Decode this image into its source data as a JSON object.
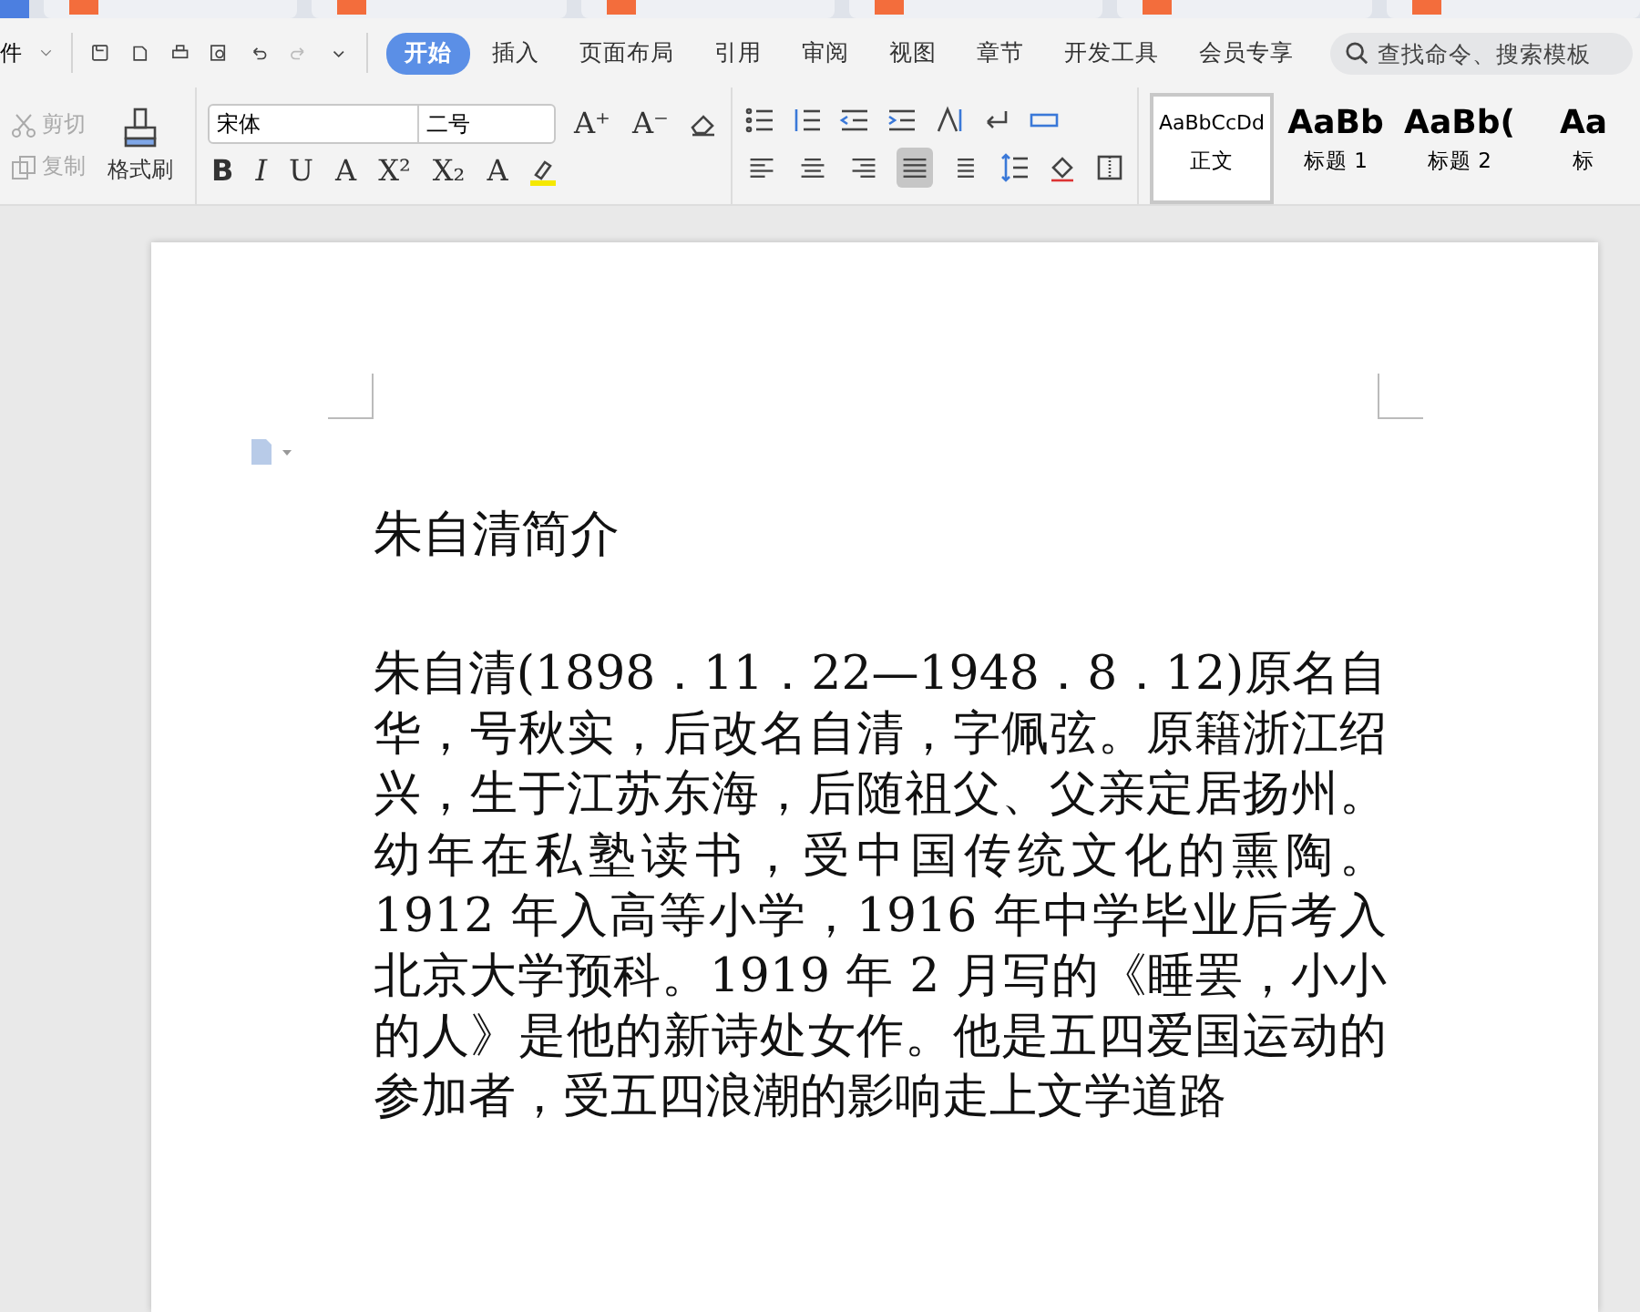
{
  "menu_bar": {
    "file_menu": "件",
    "tabs": [
      {
        "label": "开始",
        "selected": true
      },
      {
        "label": "插入",
        "selected": false
      },
      {
        "label": "页面布局",
        "selected": false
      },
      {
        "label": "引用",
        "selected": false
      },
      {
        "label": "审阅",
        "selected": false
      },
      {
        "label": "视图",
        "selected": false
      },
      {
        "label": "章节",
        "selected": false
      },
      {
        "label": "开发工具",
        "selected": false
      },
      {
        "label": "会员专享",
        "selected": false
      }
    ],
    "search": {
      "placeholder": "查找命令、搜索模板"
    }
  },
  "ribbon": {
    "clipboard": [
      {
        "label": "剪切",
        "disabled": true
      },
      {
        "label": "复制",
        "disabled": true
      }
    ],
    "format_painter": "格式刷",
    "font": {
      "family": "宋体",
      "size": "二号"
    },
    "font_row1": [
      "A⁺",
      "A⁻"
    ],
    "font_row2": [
      "B",
      "I",
      "U",
      "A",
      "X²",
      "X₂",
      "A"
    ],
    "align": [
      {
        "kind": "left",
        "selected": false
      },
      {
        "kind": "center",
        "selected": false
      },
      {
        "kind": "right",
        "selected": false
      },
      {
        "kind": "justify",
        "selected": true
      },
      {
        "kind": "distribute",
        "selected": false
      }
    ],
    "styles": [
      {
        "preview": "AaBbCcDd",
        "label": "正文",
        "kind": "normal",
        "selected": true
      },
      {
        "preview": "AaBb",
        "label": "标题 1",
        "kind": "h1",
        "selected": false
      },
      {
        "preview": "AaBb(",
        "label": "标题 2",
        "kind": "h2",
        "selected": false
      },
      {
        "preview": "Aa",
        "label": "标",
        "kind": "h3",
        "selected": false
      }
    ]
  },
  "document": {
    "title": "朱自清简介",
    "body": "朱自清(1898．11．22—1948．8．12)原名自华，号秋实，后改名自清，字佩弦。原籍浙江绍兴，生于江苏东海，后随祖父、父亲定居扬州。幼年在私塾读书，受中国传统文化的熏陶。1912 年入高等小学，1916 年中学毕业后考入北京大学预科。1919 年 2 月写的《睡罢，小小的人》是他的新诗处女作。他是五四爱国运动的参加者，受五四浪潮的影响走上文学道路"
  }
}
